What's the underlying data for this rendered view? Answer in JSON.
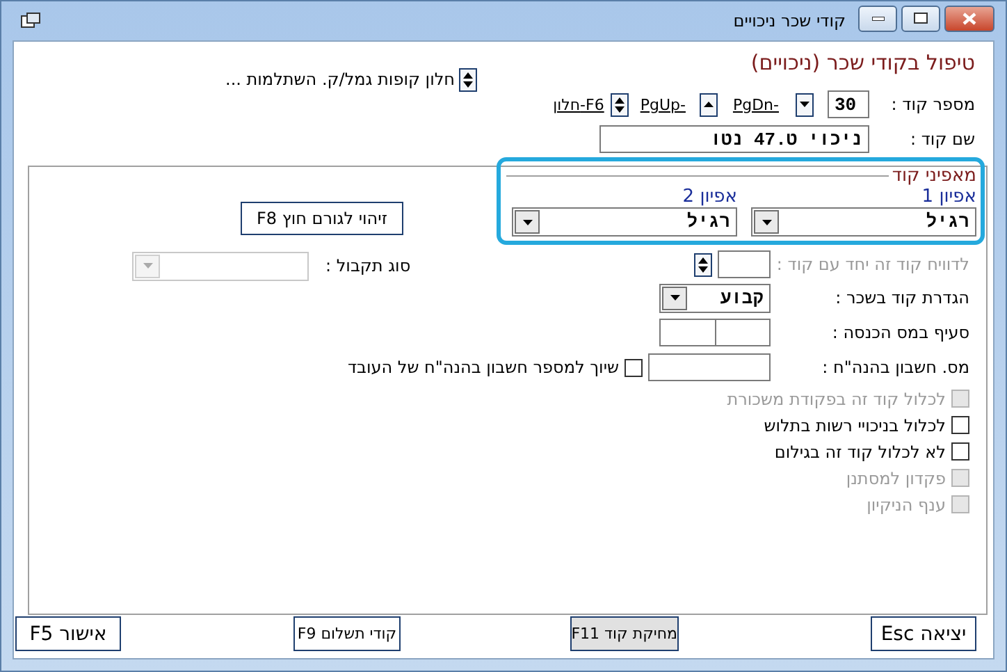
{
  "window": {
    "title": "קודי שכר ניכויים"
  },
  "heading": "טיפול בקודי שכר (ניכויים)",
  "funds_link": "חלון קופות גמל/ק. השתלמות ...",
  "code_row": {
    "label": "מספר קוד :",
    "value": "30",
    "next_link": "PgDn-",
    "prev_link": "PgUp-",
    "window_link": "חלון-F6"
  },
  "name_row": {
    "label": "שם קוד :",
    "value": "ניכוי ט.47 נטו"
  },
  "external_button": "זיהוי לגורם חוץ F8",
  "receipt_type": {
    "label": "סוג תקבול :",
    "disabled": true
  },
  "characteristics": {
    "title": "מאפיני קוד",
    "options": [
      {
        "label": "אפיון 1",
        "value": "רגיל"
      },
      {
        "label": "אפיון 2",
        "value": "רגיל"
      }
    ]
  },
  "report_with": {
    "label": "לדוויח קוד זה יחד עם קוד :",
    "disabled": true
  },
  "salary_definition": {
    "label": "הגדרת קוד בשכר :",
    "value": "קבוע"
  },
  "tax_section": {
    "label": "סעיף במס הכנסה :"
  },
  "account": {
    "label": "מס. חשבון בהנה\"ח :",
    "checkbox_label": "שיוך למספר חשבון בהנה\"ח של העובד",
    "checked": false
  },
  "checkboxes": [
    {
      "label": "לכלול קוד זה בפקודת משכורת",
      "checked": false,
      "disabled": true
    },
    {
      "label": "לכלול בניכויי רשות בתלוש",
      "checked": false,
      "disabled": false
    },
    {
      "label": "לא לכלול קוד זה בגילום",
      "checked": false,
      "disabled": false
    },
    {
      "label": "פקדון למסתנן",
      "checked": false,
      "disabled": true
    },
    {
      "label": "ענף הניקיון",
      "checked": false,
      "disabled": true
    }
  ],
  "buttons": [
    {
      "label": "יציאה Esc",
      "highlighted": false
    },
    {
      "label": "מחיקת קוד F11",
      "highlighted": true
    },
    {
      "label": "קודי תשלום F9",
      "highlighted": false
    },
    {
      "label": "אישור F5",
      "highlighted": false
    }
  ]
}
